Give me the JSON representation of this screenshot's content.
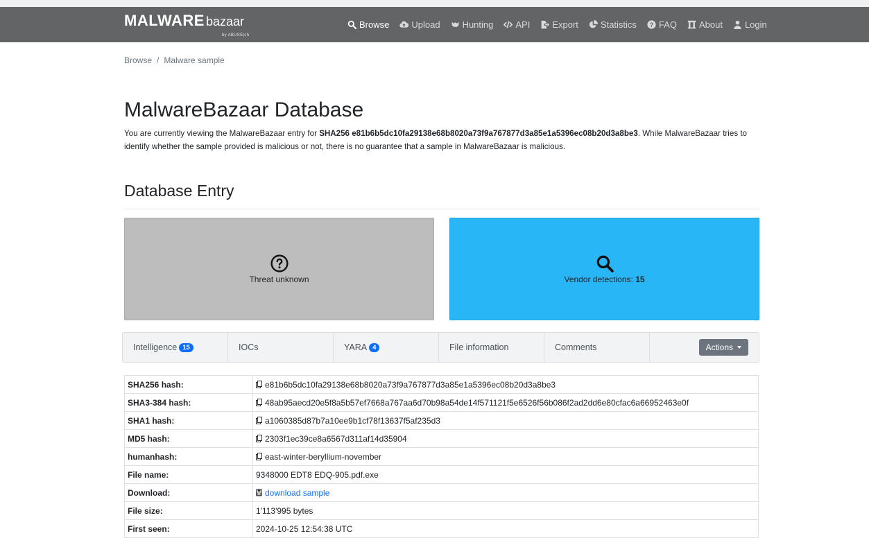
{
  "brand": {
    "main": "MALWARE",
    "sub": "bazaar",
    "by": "by ABUSE|ch"
  },
  "nav": [
    {
      "label": "Browse",
      "icon": "search-icon",
      "active": true
    },
    {
      "label": "Upload",
      "icon": "cloud-upload-icon"
    },
    {
      "label": "Hunting",
      "icon": "hunting-icon"
    },
    {
      "label": "API",
      "icon": "code-icon"
    },
    {
      "label": "Export",
      "icon": "export-icon"
    },
    {
      "label": "Statistics",
      "icon": "pie-chart-icon"
    },
    {
      "label": "FAQ",
      "icon": "question-circle-icon"
    },
    {
      "label": "About",
      "icon": "building-icon"
    },
    {
      "label": "Login",
      "icon": "user-icon"
    }
  ],
  "breadcrumb": {
    "home": "Browse",
    "separator": "/",
    "current": "Malware sample"
  },
  "page": {
    "title": "MalwareBazaar Database",
    "intro_prefix": "You are currently viewing the MalwareBazaar entry for ",
    "intro_hash": "SHA256 e81b6b5dc10fa29138e68b8020a73f9a767877d3a85e1a5396ec08b20d3a8be3",
    "intro_suffix": ". While MalwareBazaar tries to identify whether the sample provided is malicious or not, there is no guarantee that a sample in MalwareBazaar is malicious."
  },
  "section": {
    "title": "Database Entry"
  },
  "cards": {
    "threat": {
      "label": "Threat unknown",
      "icon": "question-circle-icon",
      "color": "#bdbdbd"
    },
    "vendor": {
      "label": "Vendor detections: ",
      "count": "15",
      "icon": "search-icon",
      "color": "#29b6f6"
    }
  },
  "tabs": [
    {
      "label": "Intelligence",
      "badge": "15"
    },
    {
      "label": "IOCs"
    },
    {
      "label": "YARA",
      "badge": "4"
    },
    {
      "label": "File information"
    },
    {
      "label": "Comments"
    }
  ],
  "actions_label": "Actions",
  "details": [
    {
      "key": "SHA256 hash:",
      "value": "e81b6b5dc10fa29138e68b8020a73f9a767877d3a85e1a5396ec08b20d3a8be3",
      "icon": "copy-icon"
    },
    {
      "key": "SHA3-384 hash:",
      "value": "48ab95aecd20e5f8a5b57ef7668a767aa6d70b98a54de14f571121f5e6526f56b086f2ad2dd6e80cfac6a66952463e0f",
      "icon": "copy-icon"
    },
    {
      "key": "SHA1 hash:",
      "value": "a1060385d87b7a10ee9b1cf78f13637f5af235d3",
      "icon": "copy-icon"
    },
    {
      "key": "MD5 hash:",
      "value": "2303f1ec39ce8a6567d311af14d35904",
      "icon": "copy-icon"
    },
    {
      "key": "humanhash:",
      "value": "east-winter-beryllium-november",
      "icon": "copy-icon"
    },
    {
      "key": "File name:",
      "value": "9348000 EDT8 EDQ-905.pdf.exe"
    },
    {
      "key": "Download:",
      "value": "download sample",
      "icon": "download-icon",
      "link": true
    },
    {
      "key": "File size:",
      "value": "1'113'995 bytes"
    },
    {
      "key": "First seen:",
      "value": "2024-10-25 12:54:38 UTC"
    }
  ]
}
